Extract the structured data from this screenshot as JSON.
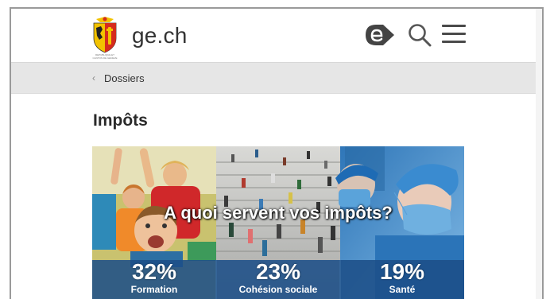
{
  "header": {
    "site_name": "ge.ch",
    "logo_caption": "REPUBLIQUE ET CANTON DE GENEVE",
    "easy_icon": "easy-read-icon",
    "search_icon": "search-icon",
    "menu_icon": "hamburger-menu-icon"
  },
  "breadcrumb": {
    "chevron": "‹",
    "link_label": "Dossiers"
  },
  "page": {
    "title": "Impôts"
  },
  "banner": {
    "headline": "A quoi servent vos impôts?",
    "stats": [
      {
        "percent": "32%",
        "label": "Formation"
      },
      {
        "percent": "23%",
        "label": "Cohésion sociale"
      },
      {
        "percent": "19%",
        "label": "Santé"
      }
    ]
  },
  "colors": {
    "banner_blue": "#1c4f87",
    "breadcrumb_bg": "#e6e6e6",
    "logo_red": "#d52b1e",
    "logo_yellow": "#f2c200"
  }
}
